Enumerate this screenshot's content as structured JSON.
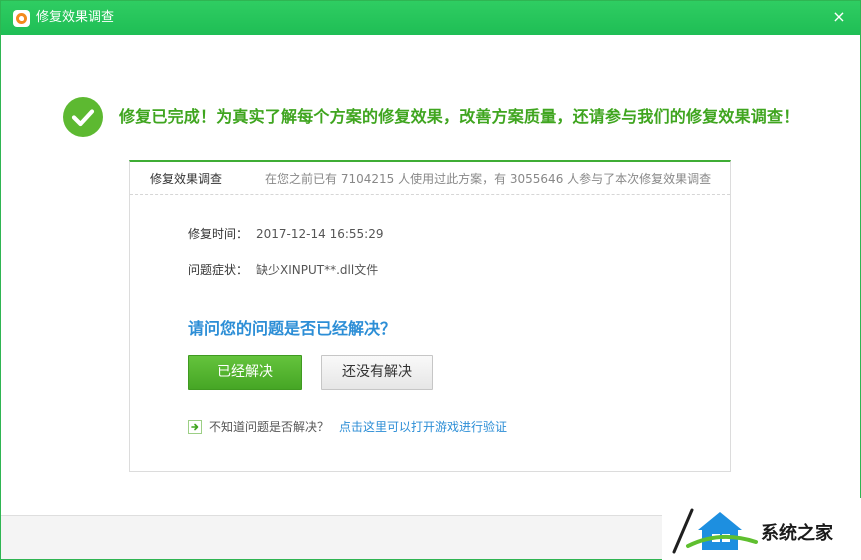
{
  "window": {
    "title": "修复效果调查",
    "close_glyph": "×",
    "accent_color": "#22c55a"
  },
  "success": {
    "icon": "check-circle-icon",
    "message": "修复已完成！为真实了解每个方案的修复效果，改善方案质量，还请参与我们的修复效果调查！"
  },
  "survey": {
    "title": "修复效果调查",
    "stats": "在您之前已有 7104215 人使用过此方案，有 3055646 人参与了本次修复效果调查",
    "repair_time_label": "修复时间：",
    "repair_time_value": "2017-12-14 16:55:29",
    "symptom_label": "问题症状：",
    "symptom_value": "缺少XINPUT**.dll文件",
    "question": "请问您的问题是否已经解决？",
    "solved_button": "已经解决",
    "unsolved_button": "还没有解决",
    "verify_icon": "arrow-right-icon",
    "verify_text": "不知道问题是否解决？",
    "verify_link": "点击这里可以打开游戏进行验证"
  },
  "watermark": {
    "text": "系统之家"
  }
}
